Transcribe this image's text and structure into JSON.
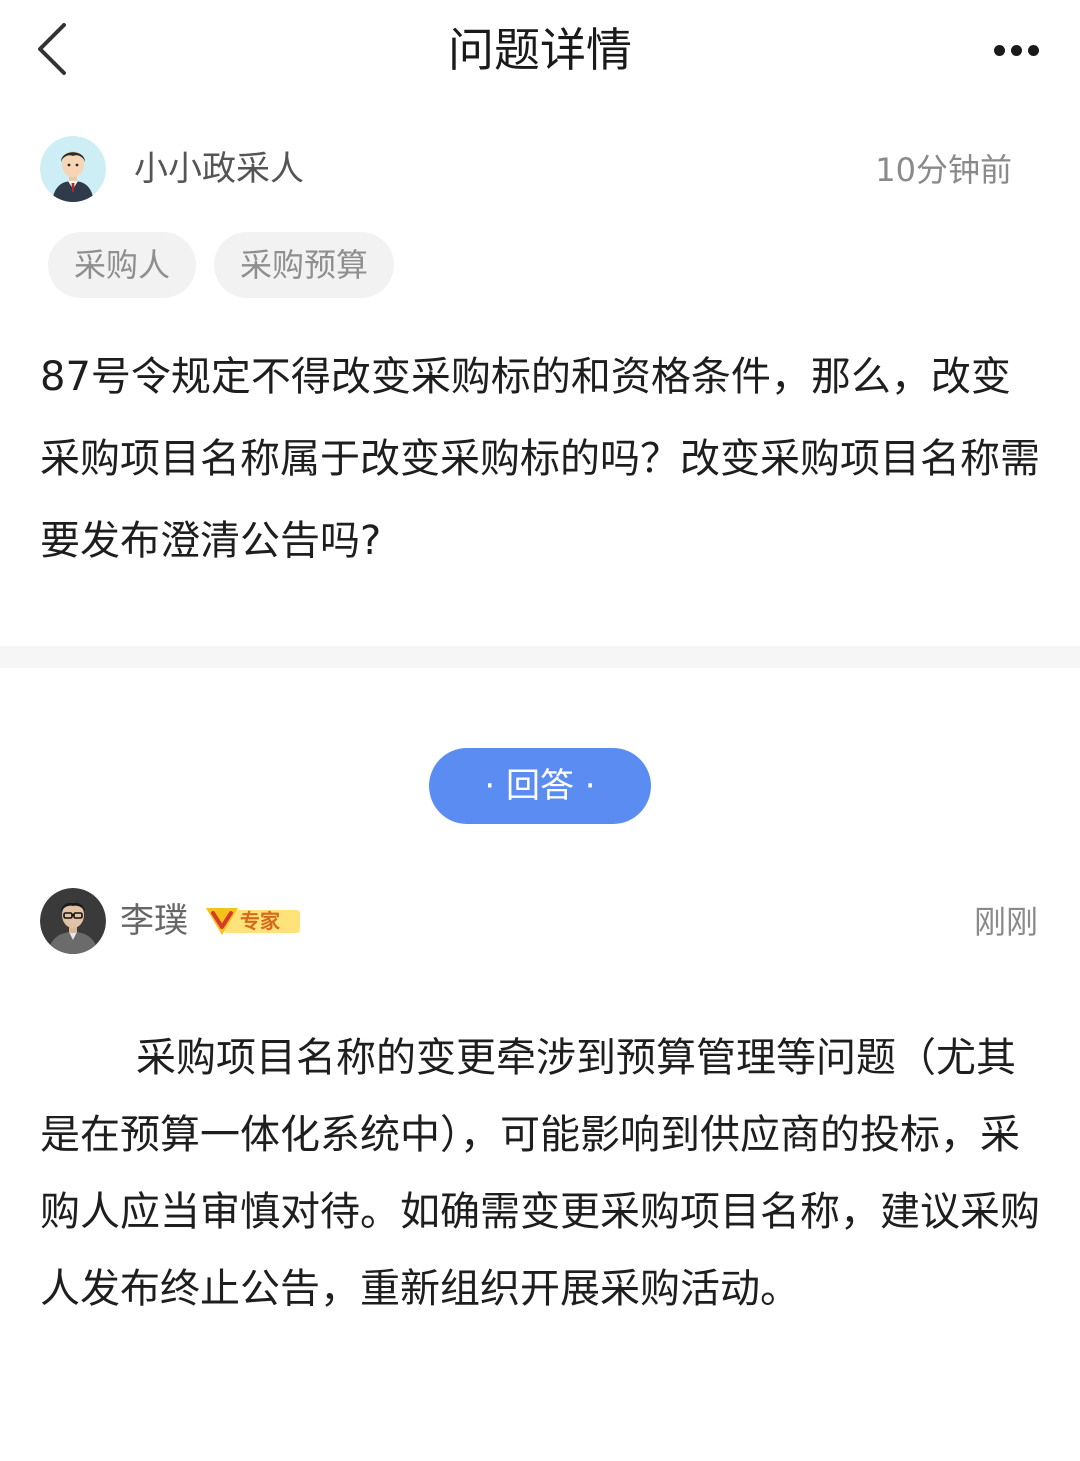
{
  "header": {
    "title": "问题详情"
  },
  "question": {
    "author": "小小政采人",
    "time": "10分钟前",
    "tags": [
      "采购人",
      "采购预算"
    ],
    "text": "87号令规定不得改变采购标的和资格条件，那么，改变采购项目名称属于改变采购标的吗？改变采购项目名称需要发布澄清公告吗?"
  },
  "answer_section": {
    "label": "· 回答 ·"
  },
  "answer": {
    "author": "李璞",
    "badge": "专家",
    "time": "刚刚",
    "text": "采购项目名称的变更牵涉到预算管理等问题（尤其是在预算一体化系统中），可能影响到供应商的投标，采购人应当审慎对待。如确需变更采购项目名称，建议采购人发布终止公告，重新组织开展采购活动。"
  },
  "colors": {
    "accent": "#5b8cf2",
    "tag_bg": "#f2f2f2",
    "badge_gold": "#f5c21b"
  }
}
